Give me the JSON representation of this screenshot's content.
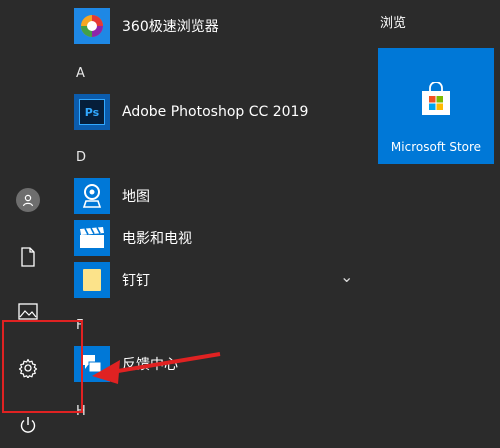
{
  "rail": {
    "items": [
      {
        "name": "user-avatar",
        "icon": "person-icon"
      },
      {
        "name": "documents",
        "icon": "document-icon"
      },
      {
        "name": "pictures",
        "icon": "picture-icon"
      },
      {
        "name": "settings",
        "icon": "gear-icon"
      },
      {
        "name": "power",
        "icon": "power-icon"
      }
    ]
  },
  "app_list": {
    "sections": [
      {
        "letter": "A"
      },
      {
        "letter": "D"
      },
      {
        "letter": "F"
      },
      {
        "letter": "H"
      }
    ],
    "apps": [
      {
        "label": "360极速浏览器",
        "icon": "360-browser-icon"
      },
      {
        "label": "Adobe Photoshop CC 2019",
        "icon": "photoshop-icon",
        "icon_text": "Ps"
      },
      {
        "label": "地图",
        "icon": "maps-icon"
      },
      {
        "label": "电影和电视",
        "icon": "movies-tv-icon"
      },
      {
        "label": "钉钉",
        "icon": "folder-icon",
        "expand_glyph": "⌄"
      },
      {
        "label": "反馈中心",
        "icon": "feedback-hub-icon"
      }
    ]
  },
  "tiles": {
    "group_title": "浏览",
    "store": {
      "label": "Microsoft Store",
      "color": "#0078d7"
    }
  },
  "annotation": {
    "color": "#e02222"
  }
}
